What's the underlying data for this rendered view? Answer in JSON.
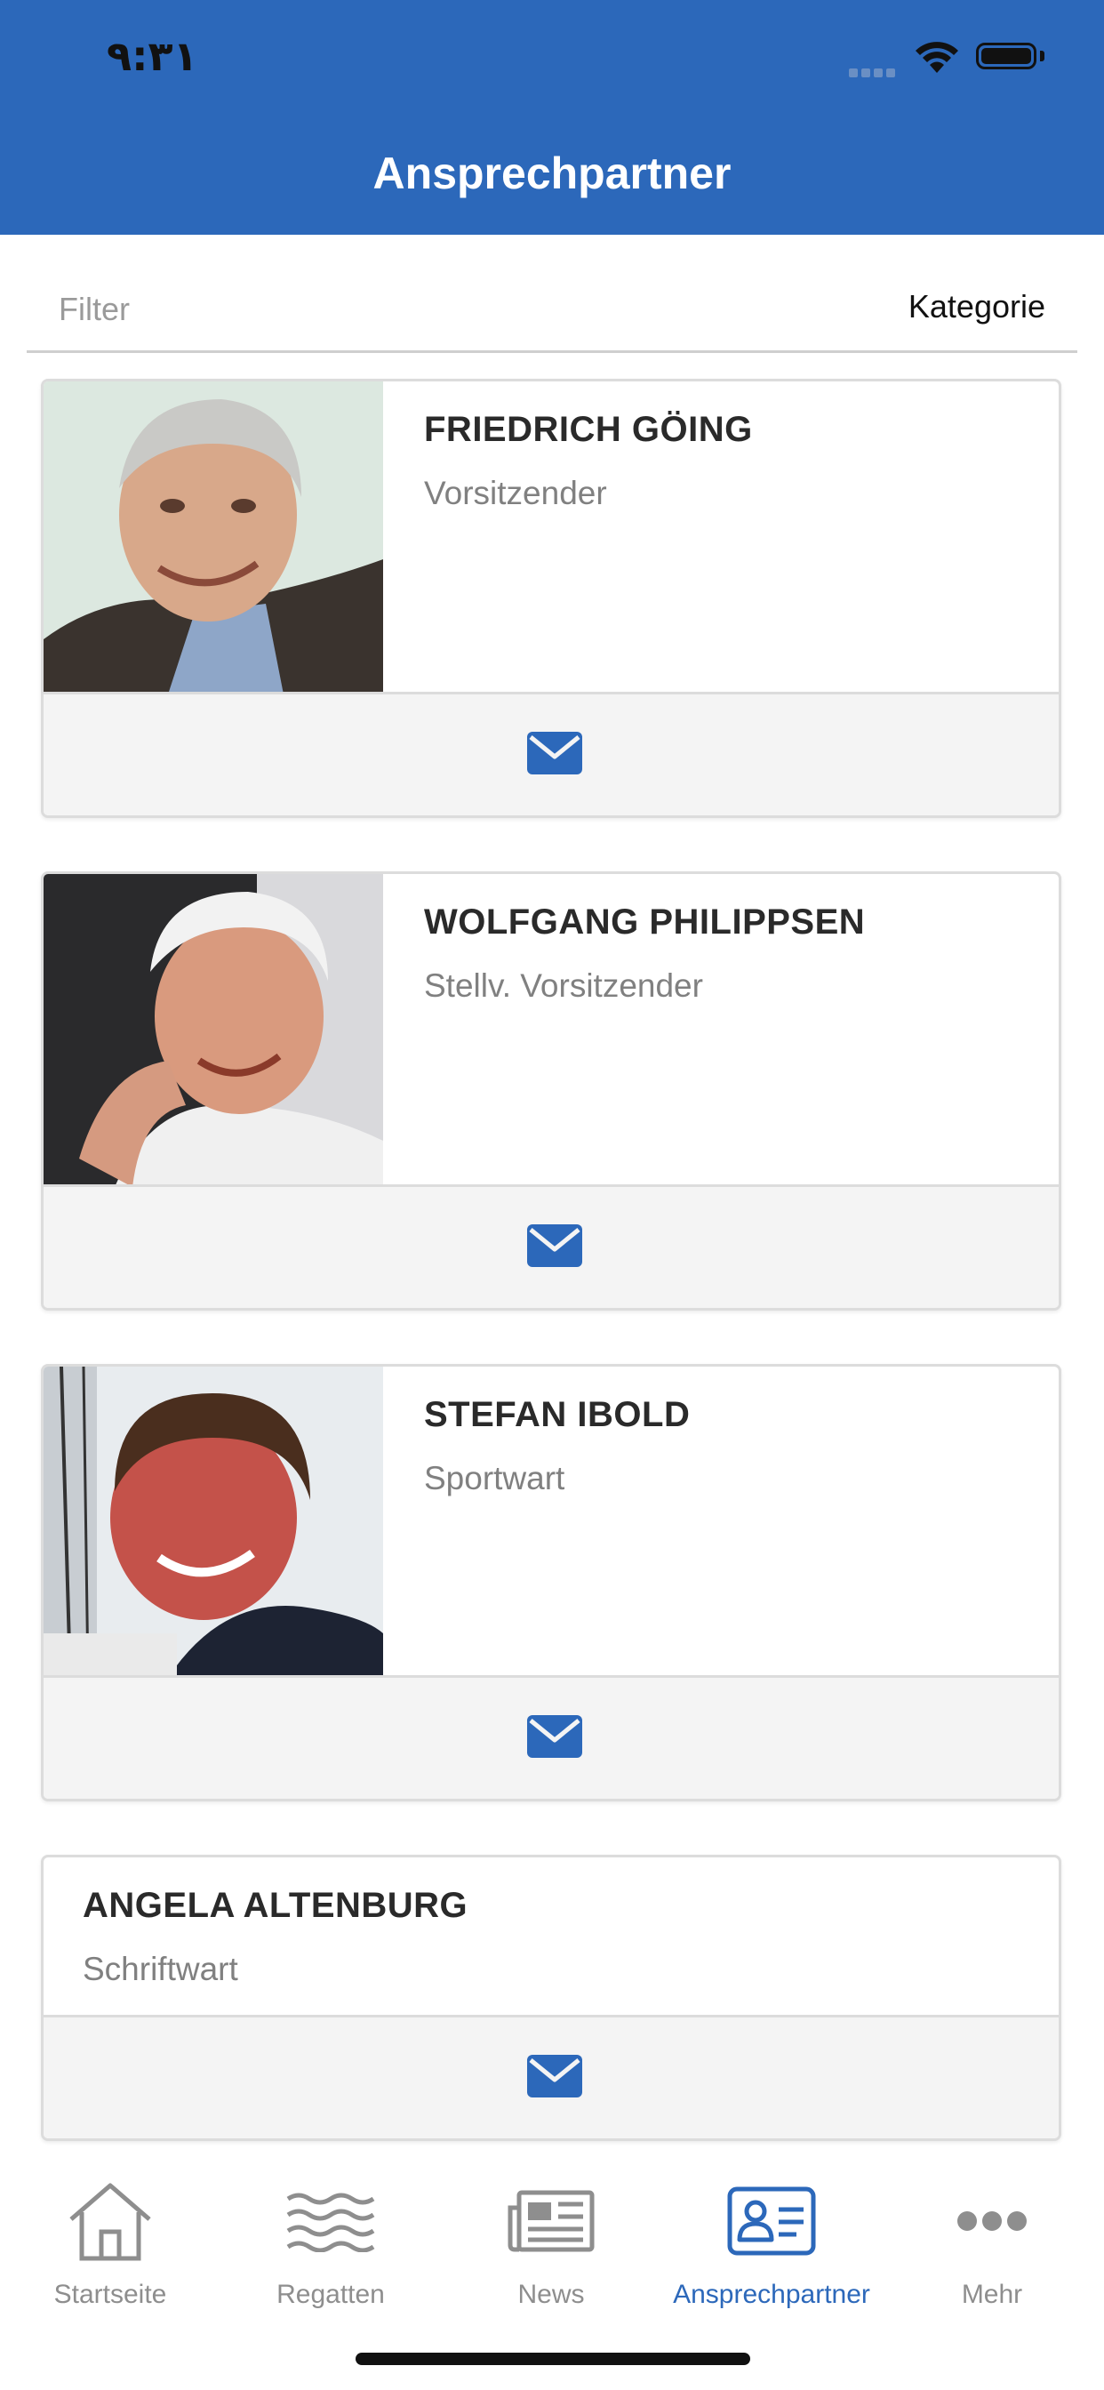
{
  "status_bar": {
    "time": "٩:٣١"
  },
  "header": {
    "title": "Ansprechpartner"
  },
  "filter": {
    "placeholder": "Filter",
    "category_label": "Kategorie"
  },
  "contacts": [
    {
      "name": "FRIEDRICH GÖING",
      "role": "Vorsitzender",
      "has_photo": true
    },
    {
      "name": "WOLFGANG PHILIPPSEN",
      "role": "Stellv. Vorsitzender",
      "has_photo": true
    },
    {
      "name": "STEFAN IBOLD",
      "role": "Sportwart",
      "has_photo": true
    },
    {
      "name": "ANGELA ALTENBURG",
      "role": "Schriftwart",
      "has_photo": false
    }
  ],
  "tabs": [
    {
      "label": "Startseite",
      "icon": "home-icon"
    },
    {
      "label": "Regatten",
      "icon": "waves-icon"
    },
    {
      "label": "News",
      "icon": "newspaper-icon"
    },
    {
      "label": "Ansprechpartner",
      "icon": "contact-card-icon",
      "active": true
    },
    {
      "label": "Mehr",
      "icon": "more-icon"
    }
  ],
  "colors": {
    "brand": "#2C68BA",
    "card_footer": "#F4F4F4",
    "inactive_tab": "#8E8E8E"
  }
}
